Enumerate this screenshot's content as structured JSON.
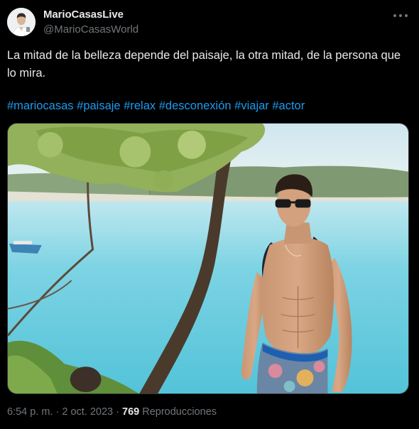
{
  "author": {
    "display_name": "MarioCasasLive",
    "handle": "@MarioCasasWorld"
  },
  "tweet": {
    "text": "La mitad de la belleza depende del paisaje, la otra mitad, de la persona que lo mira.",
    "hashtags": [
      "#mariocasas",
      "#paisaje",
      "#relax",
      "#desconexión",
      "#viajar",
      "#actor"
    ]
  },
  "media": {
    "icon": "photo"
  },
  "meta": {
    "time": "6:54 p. m.",
    "separator": " · ",
    "date": "2 oct. 2023",
    "views_count": "769",
    "views_label": "Reproducciones"
  },
  "colors": {
    "background": "#000000",
    "text": "#e7e9ea",
    "secondary": "#71767b",
    "link": "#1d9bf0"
  }
}
